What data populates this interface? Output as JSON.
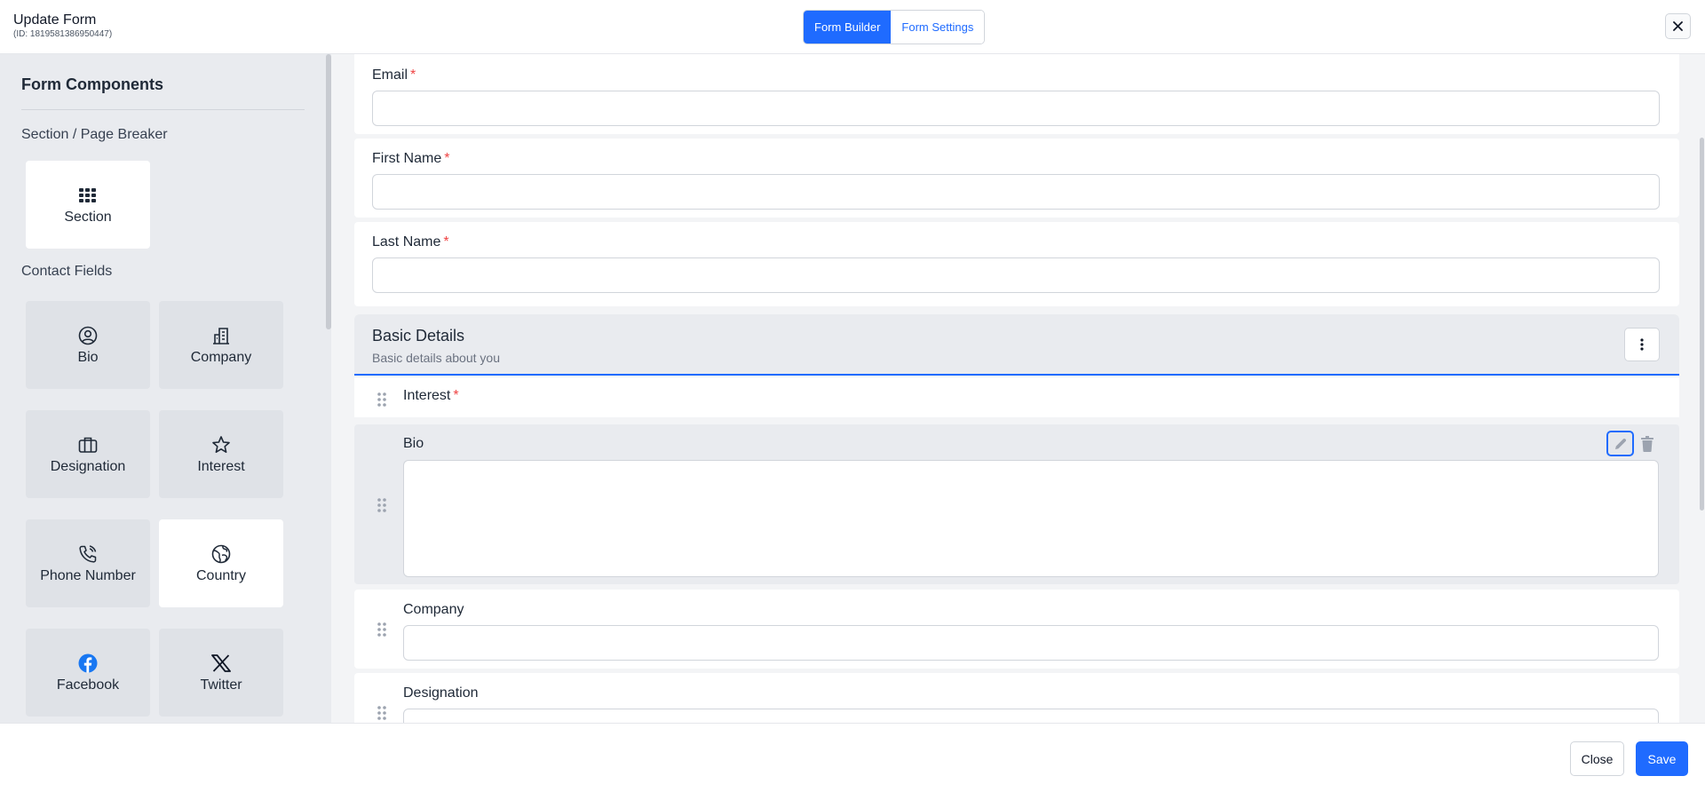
{
  "header": {
    "title": "Update Form",
    "id_text": "(ID: 1819581386950447)",
    "tabs": [
      {
        "label": "Form Builder",
        "active": true
      },
      {
        "label": "Form Settings",
        "active": false
      }
    ],
    "close_icon": "close-icon"
  },
  "sidebar": {
    "heading": "Form Components",
    "categories": {
      "section": "Section / Page Breaker",
      "contact": "Contact Fields"
    },
    "tiles": [
      {
        "label": "Section",
        "icon": "grid-icon"
      },
      {
        "label": "Bio",
        "icon": "user-circle-icon"
      },
      {
        "label": "Company",
        "icon": "building-icon"
      },
      {
        "label": "Designation",
        "icon": "briefcase-icon"
      },
      {
        "label": "Interest",
        "icon": "star-icon"
      },
      {
        "label": "Phone Number",
        "icon": "phone-icon"
      },
      {
        "label": "Country",
        "icon": "globe-icon"
      },
      {
        "label": "Facebook",
        "icon": "facebook-icon"
      },
      {
        "label": "Twitter",
        "icon": "x-twitter-icon"
      }
    ]
  },
  "form": {
    "fields_top": [
      {
        "label": "Email",
        "required": "*"
      },
      {
        "label": "First Name",
        "required": "*"
      },
      {
        "label": "Last Name",
        "required": "*"
      }
    ],
    "section": {
      "title": "Basic Details",
      "description": "Basic details about you"
    },
    "section_fields": [
      {
        "label": "Interest",
        "required": "*"
      },
      {
        "label": "Bio"
      },
      {
        "label": "Company"
      },
      {
        "label": "Designation"
      }
    ]
  },
  "footer": {
    "close_label": "Close",
    "save_label": "Save"
  },
  "colors": {
    "accent": "#1f6bff",
    "required": "#ef4444",
    "sidebar_bg": "#e9ebef"
  }
}
